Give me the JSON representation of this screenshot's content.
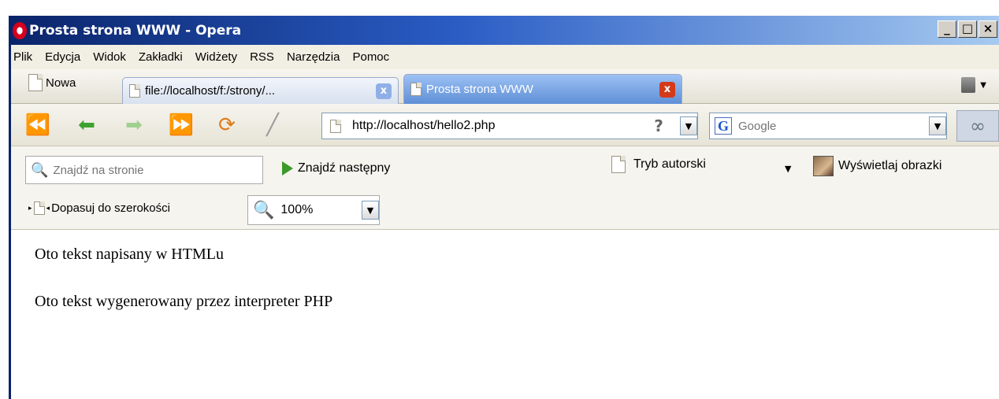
{
  "window": {
    "title": "Prosta strona WWW - Opera",
    "controls": [
      "_",
      "□",
      "×"
    ]
  },
  "menu": [
    "Plik",
    "Edycja",
    "Widok",
    "Zakładki",
    "Widżety",
    "RSS",
    "Narzędzia",
    "Pomoc"
  ],
  "tabs": {
    "new_label": "Nowa",
    "items": [
      {
        "label": "file://localhost/f:/strony/...",
        "active": false
      },
      {
        "label": "Prosta strona WWW",
        "active": true
      }
    ],
    "close_glyph": "x"
  },
  "nav": {
    "address": "http://localhost/hello2.php",
    "address_help": "?",
    "search_placeholder": "Google",
    "search_engine_logo": "G"
  },
  "find": {
    "placeholder": "Znajdź na stronie",
    "find_next_label": "Znajdź następny",
    "author_mode_label": "Tryb autorski",
    "show_images_label": "Wyświetlaj obrazki"
  },
  "zoom": {
    "fit_width_label": "Dopasuj do szerokości",
    "value": "100%"
  },
  "page": {
    "paragraphs": [
      "Oto tekst napisany w HTMLu",
      "Oto tekst wygenerowany przez interpreter PHP"
    ]
  },
  "icons": {
    "back": "rewind-icon",
    "prev": "back-arrow-icon",
    "next": "forward-arrow-icon",
    "fast_forward": "fast-forward-icon",
    "reload": "reload-icon",
    "edit": "pen-icon"
  },
  "colors": {
    "titlebar_start": "#0a246a",
    "titlebar_end": "#a6caf0",
    "active_tab": "#5f8fd6",
    "close_red": "#d43a1a"
  }
}
